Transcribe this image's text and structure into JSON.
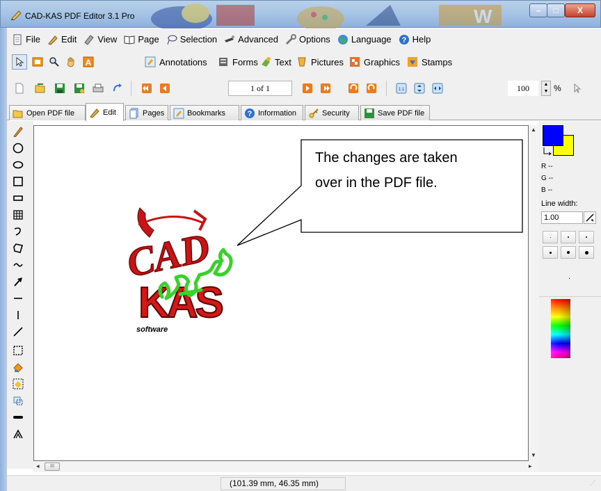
{
  "window": {
    "title": "CAD-KAS PDF Editor 3.1 Pro",
    "controls": {
      "minimize": "–",
      "maximize": "□",
      "close": "X"
    }
  },
  "menu": [
    {
      "label": "File",
      "icon": "file-icon"
    },
    {
      "label": "Edit",
      "icon": "pencil-icon"
    },
    {
      "label": "View",
      "icon": "view-icon"
    },
    {
      "label": "Page",
      "icon": "book-icon"
    },
    {
      "label": "Selection",
      "icon": "lasso-icon"
    },
    {
      "label": "Advanced",
      "icon": "wand-icon"
    },
    {
      "label": "Options",
      "icon": "wrench-icon"
    },
    {
      "label": "Language",
      "icon": "globe-icon"
    },
    {
      "label": "Help",
      "icon": "help-icon"
    }
  ],
  "toolbar1": {
    "sections": [
      "Annotations",
      "Forms",
      "Text",
      "Pictures",
      "Graphics",
      "Stamps"
    ]
  },
  "toolbar2": {
    "page_indicator": "1 of 1",
    "zoom_value": "100",
    "zoom_unit": "%"
  },
  "tabs": [
    "Open PDF file",
    "Edit",
    "Pages",
    "Bookmarks",
    "Information",
    "Security",
    "Save PDF file"
  ],
  "active_tab": "Edit",
  "canvas": {
    "callout_lines": [
      "The changes are taken",
      "over in the PDF file."
    ],
    "logo_sub": "software"
  },
  "right_panel": {
    "r_label": "R --",
    "g_label": "G --",
    "b_label": "B --",
    "line_width_label": "Line width:",
    "line_width_value": "1.00",
    "small_dot": ".",
    "colors": {
      "foreground": "#0000ff",
      "background": "#ffff00"
    }
  },
  "status": {
    "coordinates": "(101.39 mm, 46.35 mm)"
  },
  "colors": {
    "accent_blue": "#1a5fb4",
    "logo_red": "#c81414",
    "scribble_green": "#3ad12b"
  }
}
